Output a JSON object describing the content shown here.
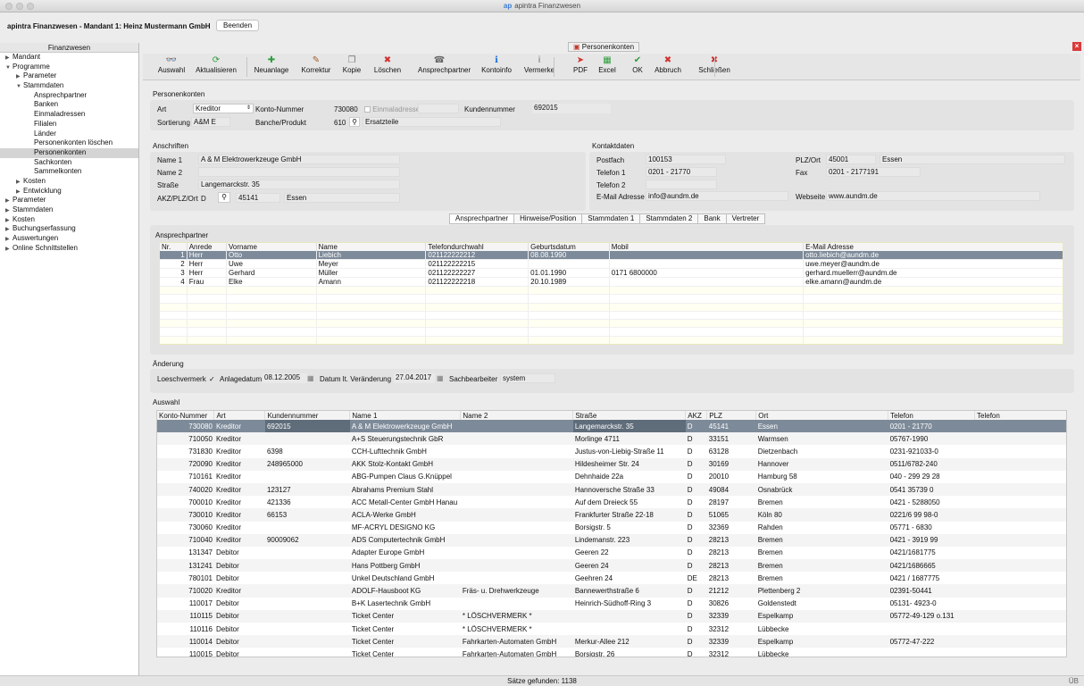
{
  "window": {
    "title": "apintra Finanzwesen",
    "logo": "ap"
  },
  "header": {
    "app_title": "apintra Finanzwesen - Mandant 1: Heinz Mustermann GmbH",
    "beenden": "Beenden"
  },
  "left": {
    "title": "Finanzwesen",
    "items": [
      {
        "label": "Mandant",
        "level": 0,
        "arrow": "▶"
      },
      {
        "label": "Programme",
        "level": 0,
        "arrow": "▼"
      },
      {
        "label": "Parameter",
        "level": 1,
        "arrow": "▶"
      },
      {
        "label": "Stammdaten",
        "level": 1,
        "arrow": "▼"
      },
      {
        "label": "Ansprechpartner",
        "level": 2,
        "arrow": ""
      },
      {
        "label": "Banken",
        "level": 2,
        "arrow": ""
      },
      {
        "label": "Einmaladressen",
        "level": 2,
        "arrow": ""
      },
      {
        "label": "Filialen",
        "level": 2,
        "arrow": ""
      },
      {
        "label": "Länder",
        "level": 2,
        "arrow": ""
      },
      {
        "label": "Personenkonten löschen",
        "level": 2,
        "arrow": ""
      },
      {
        "label": "Personenkonten",
        "level": 2,
        "arrow": "",
        "selected": true
      },
      {
        "label": "Sachkonten",
        "level": 2,
        "arrow": ""
      },
      {
        "label": "Sammelkonten",
        "level": 2,
        "arrow": ""
      },
      {
        "label": "Kosten",
        "level": 1,
        "arrow": "▶"
      },
      {
        "label": "Entwicklung",
        "level": 1,
        "arrow": "▶"
      },
      {
        "label": "Parameter",
        "level": 0,
        "arrow": "▶"
      },
      {
        "label": "Stammdaten",
        "level": 0,
        "arrow": "▶"
      },
      {
        "label": "Kosten",
        "level": 0,
        "arrow": "▶"
      },
      {
        "label": "Buchungserfassung",
        "level": 0,
        "arrow": "▶"
      },
      {
        "label": "Auswertungen",
        "level": 0,
        "arrow": "▶"
      },
      {
        "label": "Online Schnittstellen",
        "level": 0,
        "arrow": "▶"
      }
    ]
  },
  "tab_title": "Personenkonten",
  "toolbar": [
    {
      "label": "Auswahl",
      "icon": "binoculars-icon",
      "glyph": "👓",
      "color": "#333"
    },
    {
      "label": "Aktualisieren",
      "icon": "refresh-icon",
      "glyph": "⟳",
      "color": "#2e9d3a"
    },
    {
      "label": "Neuanlage",
      "icon": "plus-icon",
      "glyph": "✚",
      "color": "#2e9d3a"
    },
    {
      "label": "Korrektur",
      "icon": "pencil-icon",
      "glyph": "✎",
      "color": "#a06030"
    },
    {
      "label": "Kopie",
      "icon": "copy-icon",
      "glyph": "❐",
      "color": "#777"
    },
    {
      "label": "Löschen",
      "icon": "delete-icon",
      "glyph": "✖",
      "color": "#d32f2f"
    },
    {
      "label": "Ansprechpartner",
      "icon": "contact-icon",
      "glyph": "☎",
      "color": "#666"
    },
    {
      "label": "Kontoinfo",
      "icon": "info-icon",
      "glyph": "ℹ",
      "color": "#1e6fd9"
    },
    {
      "label": "Vermerke",
      "icon": "note-icon",
      "glyph": "ⅰ",
      "color": "#666"
    },
    {
      "label": "PDF",
      "icon": "pdf-icon",
      "glyph": "➤",
      "color": "#d32f2f"
    },
    {
      "label": "Excel",
      "icon": "excel-icon",
      "glyph": "▦",
      "color": "#2e9d3a"
    },
    {
      "label": "OK",
      "icon": "check-icon",
      "glyph": "✔",
      "color": "#2e9d3a"
    },
    {
      "label": "Abbruch",
      "icon": "cancel-icon",
      "glyph": "✖",
      "color": "#d32f2f"
    },
    {
      "label": "Schließen",
      "icon": "close-icon",
      "glyph": "✖",
      "color": "#d32f2f"
    }
  ],
  "personenkonten": {
    "title": "Personenkonten",
    "art_label": "Art",
    "art_value": "Kreditor",
    "konto_label": "Konto-Nummer",
    "konto_value": "730080",
    "einmal_label": "Einmaladresse",
    "kunden_label": "Kundennummer",
    "kunden_value": "692015",
    "sort_label": "Sortierung",
    "sort_value": "A&M E",
    "branche_label": "Banche/Produkt",
    "branche_code": "610",
    "branche_value": "Ersatzteile"
  },
  "anschriften": {
    "title": "Anschriften",
    "name1_label": "Name 1",
    "name1": "A & M Elektrowerkzeuge GmbH",
    "name2_label": "Name 2",
    "name2": "",
    "strasse_label": "Straße",
    "strasse": "Langemarckstr. 35",
    "akz_label": "AKZ/PLZ/Ort",
    "akz": "D",
    "plz": "45141",
    "ort": "Essen"
  },
  "kontakt": {
    "title": "Kontaktdaten",
    "postfach_label": "Postfach",
    "postfach": "100153",
    "plzort_label": "PLZ/Ort",
    "plz": "45001",
    "ort": "Essen",
    "tel1_label": "Telefon 1",
    "tel1": "0201 - 21770",
    "fax_label": "Fax",
    "fax": "0201 - 2177191",
    "tel2_label": "Telefon 2",
    "tel2": "",
    "email_label": "E-Mail Adresse",
    "email": "info@aundm.de",
    "web_label": "Webseite",
    "web": "www.aundm.de"
  },
  "tabs": [
    "Ansprechpartner",
    "Hinweise/Position",
    "Stammdaten 1",
    "Stammdaten 2",
    "Bank",
    "Vertreter"
  ],
  "ansprech": {
    "title": "Ansprechpartner",
    "columns": [
      "Nr.",
      "Anrede",
      "Vorname",
      "Name",
      "Telefondurchwahl",
      "Geburtsdatum",
      "Mobil",
      "E-Mail Adresse"
    ],
    "rows": [
      [
        "1",
        "Herr",
        "Otto",
        "Liebich",
        "021122222212",
        "08.08.1990",
        "",
        "otto.liebich@aundm.de"
      ],
      [
        "2",
        "Herr",
        "Uwe",
        "Meyer",
        "021122222215",
        "",
        "",
        "uwe.meyer@aundm.de"
      ],
      [
        "3",
        "Herr",
        "Gerhard",
        "Müller",
        "021122222227",
        "01.01.1990",
        "0171 6800000",
        "gerhard.muellerr@aundm.de"
      ],
      [
        "4",
        "Frau",
        "Elke",
        "Amann",
        "021122222218",
        "20.10.1989",
        "",
        "elke.amann@aundm.de"
      ]
    ]
  },
  "aenderung": {
    "title": "Änderung",
    "loesch_label": "Loeschvermerk",
    "loesch_check": "✓",
    "anlage_label": "Anlagedatum",
    "anlage": "08.12.2005",
    "datum_label": "Datum lt. Veränderung",
    "datum": "27.04.2017",
    "sach_label": "Sachbearbeiter",
    "sach": "system"
  },
  "auswahl": {
    "title": "Auswahl",
    "columns": [
      "Konto-Nummer",
      "Art",
      "Kundennummer",
      "Name 1",
      "Name 2",
      "Straße",
      "AKZ",
      "PLZ",
      "Ort",
      "Telefon",
      "Telefon"
    ],
    "rows": [
      [
        "730080",
        "Kreditor",
        "692015",
        "A & M Elektrowerkzeuge GmbH",
        "",
        "Langemarckstr. 35",
        "D",
        "45141",
        "Essen",
        "0201 - 21770",
        ""
      ],
      [
        "710050",
        "Kreditor",
        "",
        "A+S Steuerungstechnik GbR",
        "",
        "Morlinge 4711",
        "D",
        "33151",
        "Warmsen",
        "05767-1990",
        ""
      ],
      [
        "731830",
        "Kreditor",
        "6398",
        "CCH-Lufttechnik GmbH",
        "",
        "Justus-von-Liebig-Straße 11",
        "D",
        "63128",
        "Dietzenbach",
        "0231-921033-0",
        ""
      ],
      [
        "720090",
        "Kreditor",
        "248965000",
        "AKK Stolz-Kontakt GmbH",
        "",
        "Hildesheimer Str. 24",
        "D",
        "30169",
        "Hannover",
        "0511/6782-240",
        ""
      ],
      [
        "710161",
        "Kreditor",
        "",
        "ABG-Pumpen Claus G.Knüppel",
        "",
        "Dehnhaide 22a",
        "D",
        "20010",
        "Hamburg 58",
        "040 - 299 29 28",
        ""
      ],
      [
        "740020",
        "Kreditor",
        "123127",
        "Abrahams Premium Stahl",
        "",
        "Hannoversche Straße 33",
        "D",
        "49084",
        "Osnabrück",
        "0541 35739 0",
        ""
      ],
      [
        "700010",
        "Kreditor",
        "421336",
        "ACC Metall-Center GmbH Hanau",
        "",
        "Auf dem Dreieck 55",
        "D",
        "28197",
        "Bremen",
        "0421 - 5288050",
        ""
      ],
      [
        "730010",
        "Kreditor",
        "66153",
        "ACLA-Werke GmbH",
        "",
        "Frankfurter Straße 22-18",
        "D",
        "51065",
        "Köln 80",
        "0221/6 99 98-0",
        ""
      ],
      [
        "730060",
        "Kreditor",
        "",
        "MF-ACRYL DESIGNO KG",
        "",
        "Borsigstr. 5",
        "D",
        "32369",
        "Rahden",
        "05771 - 6830",
        ""
      ],
      [
        "710040",
        "Kreditor",
        "90009062",
        "ADS Computertechnik GmbH",
        "",
        "Lindemanstr. 223",
        "D",
        "28213",
        "Bremen",
        "0421 - 3919 99",
        ""
      ],
      [
        "131347",
        "Debitor",
        "",
        "Adapter Europe GmbH",
        "",
        "Geeren 22",
        "D",
        "28213",
        "Bremen",
        "0421/1681775",
        ""
      ],
      [
        "131241",
        "Debitor",
        "",
        "Hans Pottberg GmbH",
        "",
        "Geeren 24",
        "D",
        "28213",
        "Bremen",
        "0421/1686665",
        ""
      ],
      [
        "780101",
        "Debitor",
        "",
        "Unkel Deutschland GmbH",
        "",
        "Geehren 24",
        "DE",
        "28213",
        "Bremen",
        "0421 / 1687775",
        ""
      ],
      [
        "710020",
        "Kreditor",
        "",
        "ADOLF-Hausboot KG",
        "Fräs- u. Drehwerkzeuge",
        "Bannewerthstraße 6",
        "D",
        "21212",
        "Plettenberg 2",
        "02391-50441",
        ""
      ],
      [
        "110017",
        "Debitor",
        "",
        "B+K Lasertechnik GmbH",
        "",
        "Heinrich-Südhoff-Ring 3",
        "D",
        "30826",
        "Goldenstedt",
        "05131- 4923-0",
        ""
      ],
      [
        "110115",
        "Debitor",
        "",
        "Ticket Center",
        "* LÖSCHVERMERK *",
        "",
        "D",
        "32339",
        "Espelkamp",
        "05772-49-129 o.131",
        ""
      ],
      [
        "110116",
        "Debitor",
        "",
        "Ticket Center",
        "* LÖSCHVERMERK *",
        "",
        "D",
        "32312",
        "Lübbecke",
        "",
        ""
      ],
      [
        "110014",
        "Debitor",
        "",
        "Ticket Center",
        "Fahrkarten-Automaten GmbH",
        "Merkur-Allee 212",
        "D",
        "32339",
        "Espelkamp",
        "05772-47-222",
        ""
      ],
      [
        "110015",
        "Debitor",
        "",
        "Ticket Center",
        "Fahrkarten-Automaten GmbH",
        "Borsigstr. 26",
        "D",
        "32312",
        "Lübbecke",
        "",
        ""
      ]
    ]
  },
  "status": {
    "found": "Sätze gefunden: 1138",
    "right": "ÜB"
  }
}
